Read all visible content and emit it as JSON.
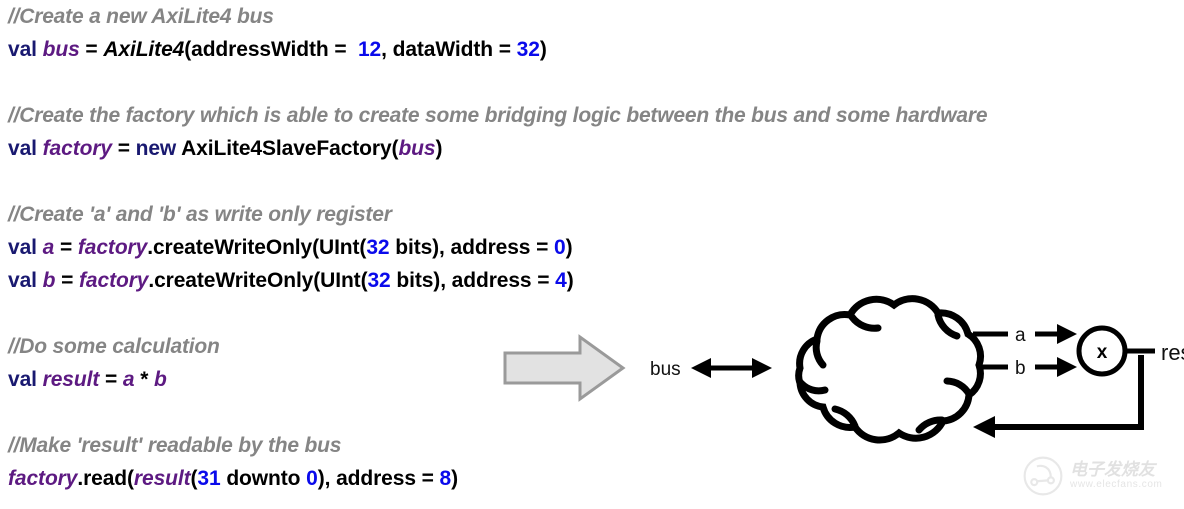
{
  "colors": {
    "comment": "#858585",
    "keyword": "#191970",
    "identifier": "#5d1a82",
    "number": "#0a0aeb",
    "plain": "#000000",
    "arrow_fill": "#e2e2e2",
    "arrow_stroke": "#9a9a9a",
    "diagram_stroke": "#000000",
    "background": "#ffffff"
  },
  "code": {
    "blocks": [
      {
        "comment": "//Create a new AxiLite4 bus",
        "tokens": [
          {
            "t": "val ",
            "c": "kw"
          },
          {
            "t": "bus",
            "c": "ident"
          },
          {
            "t": " = ",
            "c": "plain"
          },
          {
            "t": "AxiLite4",
            "c": "type"
          },
          {
            "t": "(addressWidth = ",
            "c": "plain"
          },
          {
            "t": " 12",
            "c": "num"
          },
          {
            "t": ", dataWidth = ",
            "c": "plain"
          },
          {
            "t": "32",
            "c": "num"
          },
          {
            "t": ")",
            "c": "plain"
          }
        ]
      },
      {
        "comment": "//Create the factory which is able to create some bridging logic between the bus and some hardware",
        "tokens": [
          {
            "t": "val ",
            "c": "kw"
          },
          {
            "t": "factory",
            "c": "ident"
          },
          {
            "t": " = ",
            "c": "plain"
          },
          {
            "t": "new",
            "c": "kw"
          },
          {
            "t": " AxiLite4SlaveFactory(",
            "c": "plain"
          },
          {
            "t": "bus",
            "c": "ident"
          },
          {
            "t": ")",
            "c": "plain"
          }
        ]
      },
      {
        "comment": "//Create 'a' and 'b' as write only register",
        "tokens": [
          {
            "t": "val ",
            "c": "kw"
          },
          {
            "t": "a",
            "c": "ident"
          },
          {
            "t": " = ",
            "c": "plain"
          },
          {
            "t": "factory",
            "c": "ident"
          },
          {
            "t": ".createWriteOnly(UInt(",
            "c": "plain"
          },
          {
            "t": "32",
            "c": "num"
          },
          {
            "t": " bits), address = ",
            "c": "plain"
          },
          {
            "t": "0",
            "c": "num"
          },
          {
            "t": ")",
            "c": "plain"
          }
        ],
        "tokens2": [
          {
            "t": "val ",
            "c": "kw"
          },
          {
            "t": "b",
            "c": "ident"
          },
          {
            "t": " = ",
            "c": "plain"
          },
          {
            "t": "factory",
            "c": "ident"
          },
          {
            "t": ".createWriteOnly(UInt(",
            "c": "plain"
          },
          {
            "t": "32",
            "c": "num"
          },
          {
            "t": " bits), address = ",
            "c": "plain"
          },
          {
            "t": "4",
            "c": "num"
          },
          {
            "t": ")",
            "c": "plain"
          }
        ]
      },
      {
        "comment": "//Do some calculation",
        "tokens": [
          {
            "t": "val ",
            "c": "kw"
          },
          {
            "t": "result",
            "c": "ident"
          },
          {
            "t": " = ",
            "c": "plain"
          },
          {
            "t": "a",
            "c": "ident"
          },
          {
            "t": " * ",
            "c": "plain"
          },
          {
            "t": "b",
            "c": "ident"
          }
        ]
      },
      {
        "comment": "//Make 'result' readable by the bus",
        "tokens": [
          {
            "t": "factory",
            "c": "ident"
          },
          {
            "t": ".read(",
            "c": "plain"
          },
          {
            "t": "result",
            "c": "ident"
          },
          {
            "t": "(",
            "c": "plain"
          },
          {
            "t": "31",
            "c": "num"
          },
          {
            "t": " downto ",
            "c": "plain"
          },
          {
            "t": "0",
            "c": "num"
          },
          {
            "t": "), address = ",
            "c": "plain"
          },
          {
            "t": "8",
            "c": "num"
          },
          {
            "t": ")",
            "c": "plain"
          }
        ]
      }
    ]
  },
  "diagram": {
    "big_arrow_name": "implies-arrow",
    "bus_label": "bus",
    "input_a_label": "a",
    "input_b_label": "b",
    "multiplier_label": "x",
    "output_label": "result"
  },
  "watermark": {
    "chinese": "电子发烧友",
    "url": "www.elecfans.com"
  }
}
